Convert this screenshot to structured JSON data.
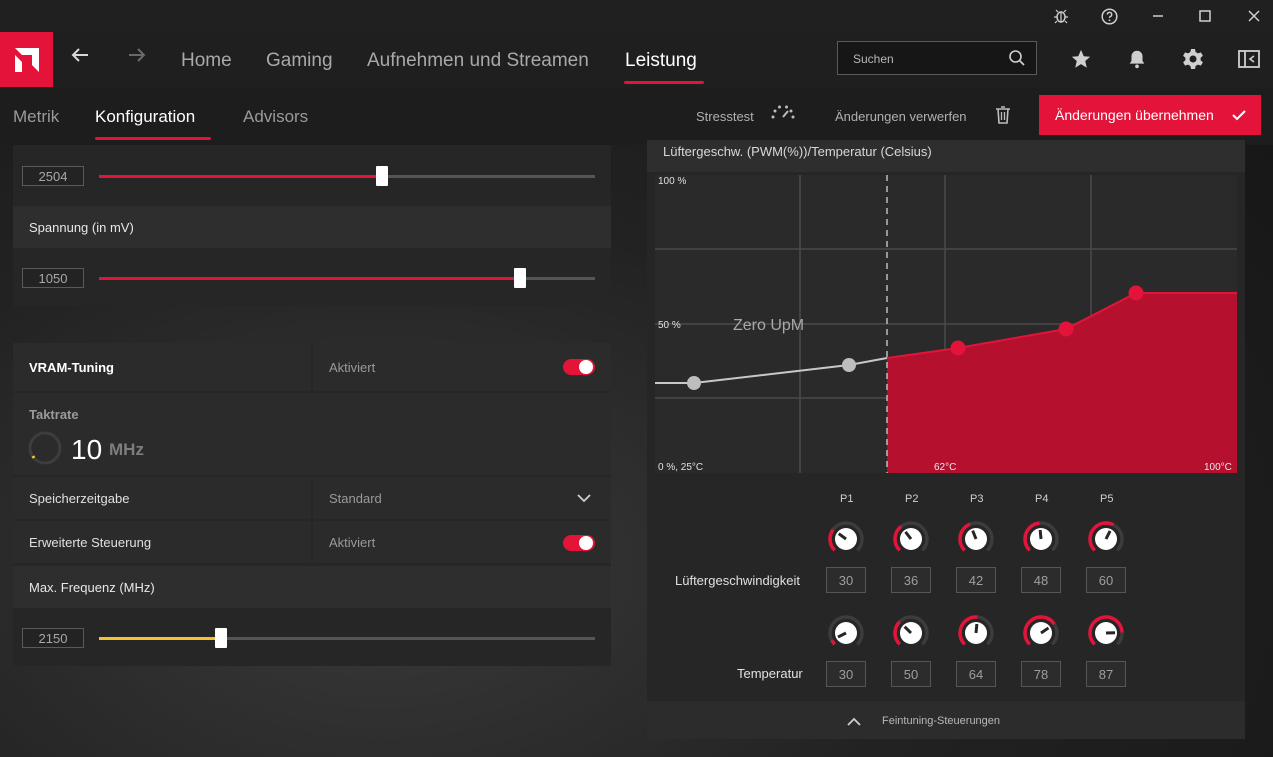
{
  "titlebar": {
    "icons": [
      "bug-icon",
      "help-icon",
      "minimize-icon",
      "maximize-icon",
      "close-icon"
    ]
  },
  "nav": {
    "items": [
      "Home",
      "Gaming",
      "Aufnehmen und Streamen",
      "Leistung"
    ],
    "active": "Leistung",
    "search_placeholder": "Suchen"
  },
  "subnav": {
    "items": [
      "Metrik",
      "Konfiguration",
      "Advisors"
    ],
    "active": "Konfiguration",
    "stresstest": "Stresstest",
    "discard": "Änderungen verwerfen",
    "apply": "Änderungen übernehmen"
  },
  "left": {
    "clock_value": "2504",
    "clock_slider": 0.57,
    "voltage_label": "Spannung (in mV)",
    "voltage_value": "1050",
    "voltage_slider": 0.85,
    "vram": {
      "title": "VRAM-Tuning",
      "state": "Aktiviert",
      "taktrate_label": "Taktrate",
      "taktrate_value": "10",
      "taktrate_unit": "MHz",
      "timing_label": "Speicherzeitgabe",
      "timing_value": "Standard",
      "advanced_label": "Erweiterte Steuerung",
      "advanced_value": "Aktiviert",
      "maxfreq_label": "Max. Frequenz (MHz)",
      "maxfreq_value": "2150",
      "maxfreq_slider": 0.25
    }
  },
  "fan": {
    "title": "Lüftergeschw. (PWM(%))/Temperatur (Celsius)",
    "y_top": "100 %",
    "y_mid": "50 %",
    "origin": "0 %, 25°C",
    "zero_rpm": "Zero UpM",
    "x_mid": "62°C",
    "x_end": "100°C",
    "points": [
      "P1",
      "P2",
      "P3",
      "P4",
      "P5"
    ],
    "speed_label": "Lüftergeschwindigkeit",
    "speeds": [
      "30",
      "36",
      "42",
      "48",
      "60"
    ],
    "temp_label": "Temperatur",
    "temps": [
      "30",
      "50",
      "64",
      "78",
      "87"
    ],
    "finetune": "Feintuning-Steuerungen",
    "accent": "#e3133a"
  },
  "chart_data": {
    "type": "area",
    "title": "Lüftergeschw. (PWM(%))/Temperatur (Celsius)",
    "x": [
      30,
      50,
      64,
      78,
      87
    ],
    "y": [
      30,
      36,
      42,
      48,
      60
    ],
    "xlim": [
      25,
      100
    ],
    "ylim": [
      0,
      100
    ],
    "annotations": [
      "Zero UpM"
    ]
  }
}
